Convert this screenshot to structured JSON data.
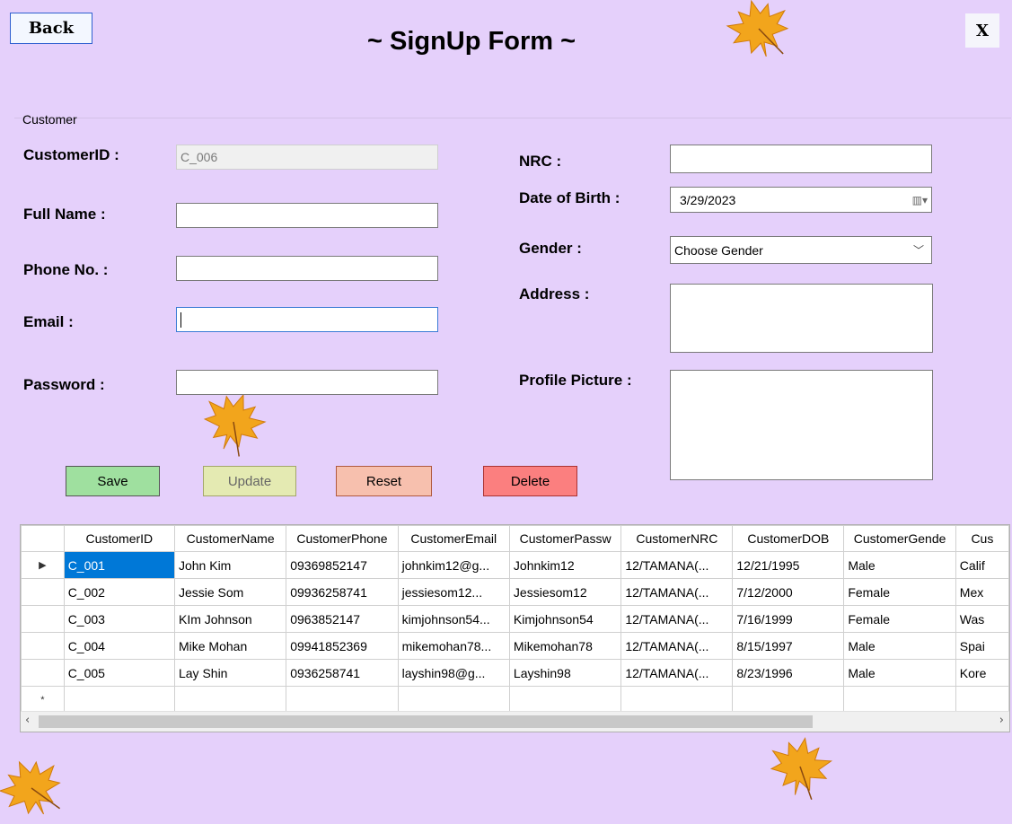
{
  "header": {
    "back_label": "Back",
    "title": "~ SignUp Form ~",
    "close_label": "X"
  },
  "group": {
    "label": "Customer"
  },
  "form": {
    "customer_id_label": "CustomerID :",
    "customer_id_value": "C_006",
    "full_name_label": "Full Name :",
    "phone_label": "Phone No.  :",
    "email_label": "Email :",
    "password_label": "Password :",
    "nrc_label": "NRC :",
    "dob_label": "Date of Birth :",
    "dob_value": "3/29/2023",
    "gender_label": "Gender :",
    "gender_value": "Choose Gender",
    "address_label": "Address :",
    "profile_label": "Profile Picture :"
  },
  "actions": {
    "save": "Save",
    "update": "Update",
    "reset": "Reset",
    "delete": "Delete"
  },
  "colors": {
    "background": "#e5d0fb",
    "save": "#9fe09f",
    "update": "#e4eab2",
    "reset": "#f7c0ae",
    "delete": "#fb7f7f",
    "selection": "#0078d7"
  },
  "grid": {
    "columns": [
      "CustomerID",
      "CustomerName",
      "CustomerPhone",
      "CustomerEmail",
      "CustomerPassw",
      "CustomerNRC",
      "CustomerDOB",
      "CustomerGende",
      "Cus"
    ],
    "rows": [
      [
        "C_001",
        "John Kim",
        "09369852147",
        "johnkim12@g...",
        "Johnkim12",
        "12/TAMANA(...",
        "12/21/1995",
        "Male",
        "Calif"
      ],
      [
        "C_002",
        "Jessie Som",
        "09936258741",
        "jessiesom12...",
        "Jessiesom12",
        "12/TAMANA(...",
        "7/12/2000",
        "Female",
        "Mex"
      ],
      [
        "C_003",
        "KIm Johnson",
        "0963852147",
        "kimjohnson54...",
        "Kimjohnson54",
        "12/TAMANA(...",
        "7/16/1999",
        "Female",
        "Was"
      ],
      [
        "C_004",
        "Mike Mohan",
        "09941852369",
        "mikemohan78...",
        "Mikemohan78",
        "12/TAMANA(...",
        "8/15/1997",
        "Male",
        "Spai"
      ],
      [
        "C_005",
        "Lay Shin",
        "0936258741",
        "layshin98@g...",
        "Layshin98",
        "12/TAMANA(...",
        "8/23/1996",
        "Male",
        "Kore"
      ]
    ],
    "current_row_glyph": "▶",
    "new_row_glyph": "*",
    "selected_cell": {
      "row": 0,
      "col": 0
    }
  }
}
